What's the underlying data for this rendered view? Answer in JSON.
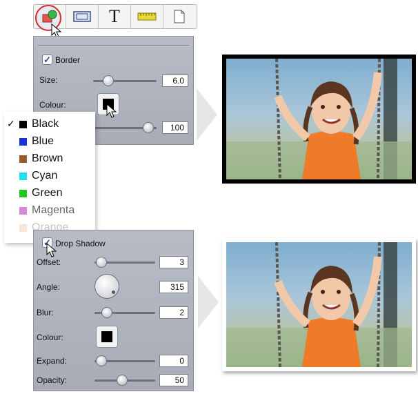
{
  "toolbar": {
    "items": [
      {
        "name": "shape-tool",
        "icon": "shape-icon"
      },
      {
        "name": "frame-tool",
        "icon": "frame-icon"
      },
      {
        "name": "text-tool",
        "icon": "text-icon",
        "glyph": "T"
      },
      {
        "name": "ruler-tool",
        "icon": "ruler-icon"
      },
      {
        "name": "page-tool",
        "icon": "page-icon"
      }
    ]
  },
  "border_panel": {
    "border_label": "Border",
    "border_checked": true,
    "size_label": "Size:",
    "size_value": "6.0",
    "colour_label": "Colour:",
    "opacity_value": "100"
  },
  "colour_menu": {
    "items": [
      {
        "label": "Black",
        "color": "#000000",
        "checked": true
      },
      {
        "label": "Blue",
        "color": "#1432d8"
      },
      {
        "label": "Brown",
        "color": "#9a5a2a"
      },
      {
        "label": "Cyan",
        "color": "#20e0f0"
      },
      {
        "label": "Green",
        "color": "#22c522"
      },
      {
        "label": "Magenta",
        "color": "#c24ac6"
      },
      {
        "label": "Orange",
        "color": "#e0a060"
      }
    ]
  },
  "shadow_panel": {
    "drop_shadow_label": "Drop Shadow",
    "drop_shadow_checked": true,
    "offset_label": "Offset:",
    "offset_value": "3",
    "angle_label": "Angle:",
    "angle_value": "315",
    "blur_label": "Blur:",
    "blur_value": "2",
    "colour_label": "Colour:",
    "expand_label": "Expand:",
    "expand_value": "0",
    "opacity_label": "Opacity:",
    "opacity_value": "50"
  },
  "colors": {
    "highlight_ring": "#d42a2a",
    "panel": "#afb3bd",
    "photo_border": "#000000"
  }
}
